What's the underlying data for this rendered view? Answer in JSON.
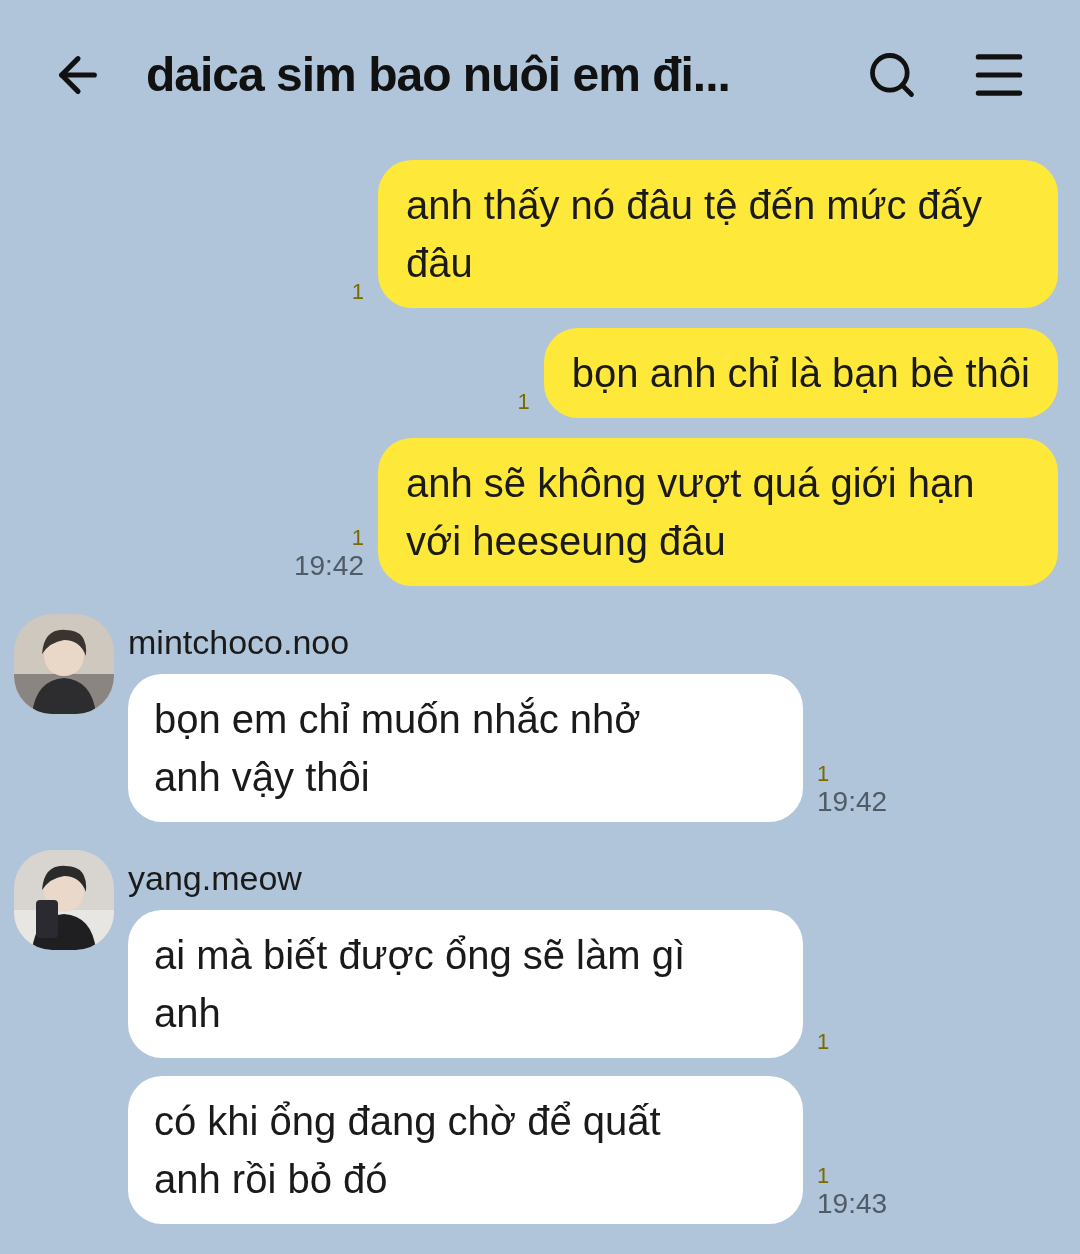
{
  "header": {
    "title": "daica sim bao nuôi em đi..."
  },
  "groups": [
    {
      "kind": "sent",
      "messages": [
        {
          "text": "anh thấy nó đâu tệ đến mức đấy đâu",
          "unread": "1"
        },
        {
          "text": "bọn anh chỉ là bạn bè thôi",
          "unread": "1"
        },
        {
          "text": "anh sẽ không vượt quá giới hạn với heeseung đâu",
          "unread": "1",
          "time": "19:42"
        }
      ]
    },
    {
      "kind": "received",
      "sender": "mintchoco.noo",
      "messages": [
        {
          "text": "bọn em chỉ muốn nhắc nhở anh vậy thôi",
          "unread": "1",
          "time": "19:42"
        }
      ]
    },
    {
      "kind": "received",
      "sender": "yang.meow",
      "messages": [
        {
          "text": "ai mà biết được ổng sẽ làm gì anh",
          "unread": "1"
        },
        {
          "text": "có khi ổng đang chờ để quất anh rồi bỏ đó",
          "unread": "1",
          "time": "19:43"
        }
      ]
    }
  ]
}
